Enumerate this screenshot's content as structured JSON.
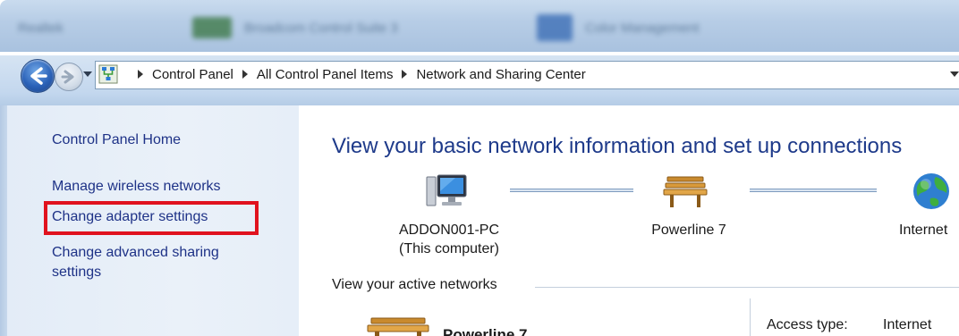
{
  "window": {
    "taskbar_blurred": [
      "Realtek",
      "Broadcom Control Suite 3",
      "Color Management"
    ]
  },
  "address_bar": {
    "breadcrumbs": [
      "Control Panel",
      "All Control Panel Items",
      "Network and Sharing Center"
    ]
  },
  "left_pane": {
    "home_link": "Control Panel Home",
    "links": [
      "Manage wireless networks",
      "Change adapter settings",
      "Change advanced sharing settings"
    ],
    "highlighted_link_index": 1,
    "highlight_color": "#e0121e"
  },
  "main": {
    "title": "View your basic network information and set up connections",
    "network_map": {
      "computer_name": "ADDON001-PC",
      "computer_sub": "(This computer)",
      "network_name": "Powerline 7",
      "internet_label": "Internet"
    },
    "active_networks_label": "View your active networks",
    "active_network": {
      "name": "Powerline 7",
      "access_type_label": "Access type:",
      "access_type_value": "Internet"
    }
  },
  "colors": {
    "link": "#1e3287",
    "title": "#1e3a8a",
    "left_pane_bg": "#e6eef8"
  },
  "icons": [
    "back-arrow-icon",
    "forward-arrow-icon",
    "network-center-icon",
    "computer-icon",
    "bench-network-icon",
    "globe-icon"
  ]
}
